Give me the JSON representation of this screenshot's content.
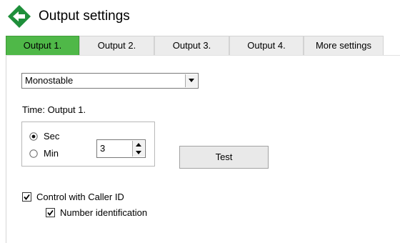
{
  "header": {
    "back_icon": "back-arrow-icon",
    "title": "Output settings"
  },
  "tabs": [
    {
      "label": "Output 1.",
      "active": true
    },
    {
      "label": "Output 2.",
      "active": false
    },
    {
      "label": "Output 3.",
      "active": false
    },
    {
      "label": "Output 4.",
      "active": false
    },
    {
      "label": "More settings",
      "active": false
    }
  ],
  "mode_select": {
    "value": "Monostable",
    "icon": "chevron-down-icon"
  },
  "time_label": "Time: Output 1.",
  "time_units": {
    "options": [
      {
        "label": "Sec",
        "selected": true
      },
      {
        "label": "Min",
        "selected": false
      }
    ],
    "value": "3"
  },
  "test_button": "Test",
  "caller_id": {
    "control_label": "Control with Caller ID",
    "control_checked": true,
    "number_label": "Number identification",
    "number_checked": true
  },
  "colors": {
    "active_tab": "#4fb848",
    "back_icon": "#1e8f3a"
  }
}
